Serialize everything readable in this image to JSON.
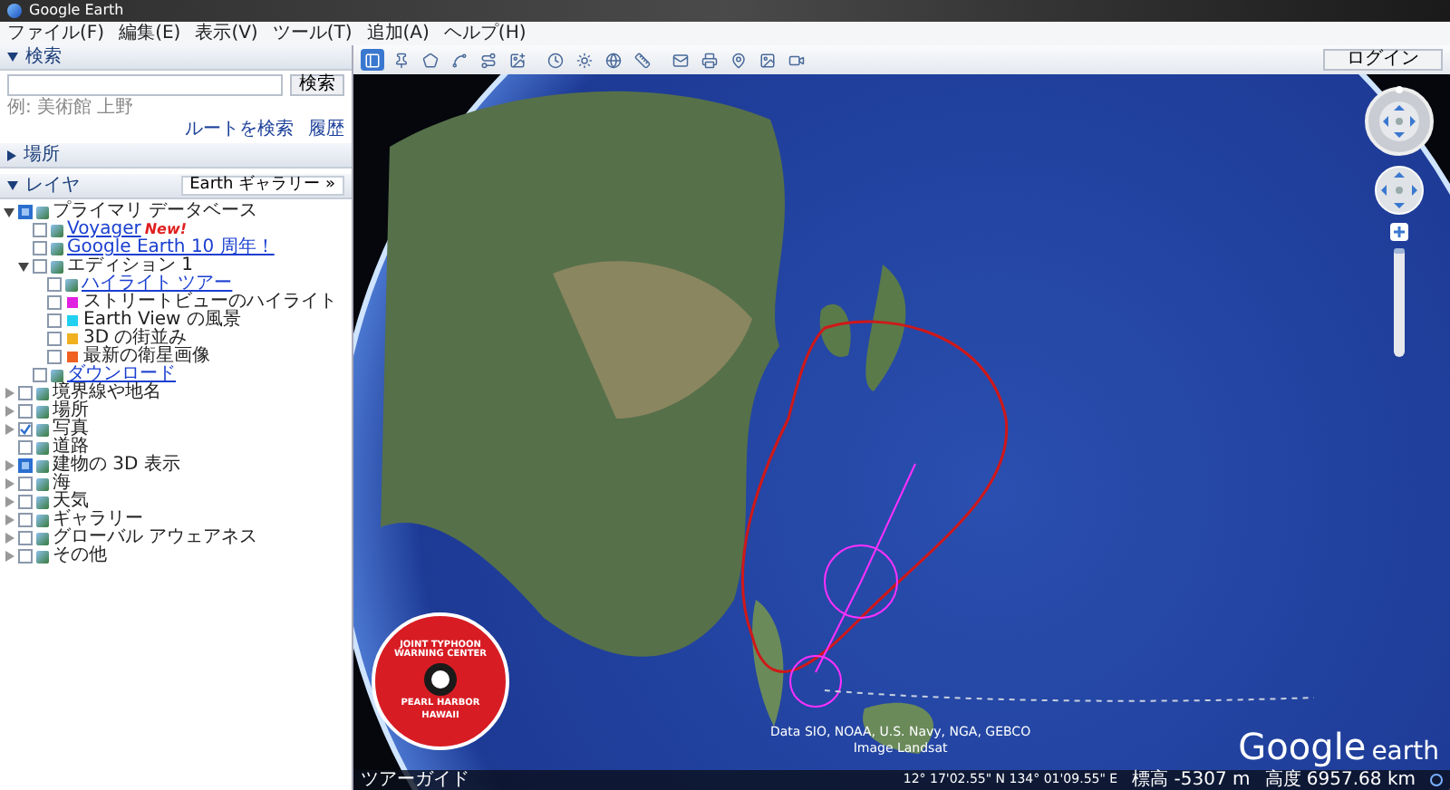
{
  "window": {
    "title": "Google Earth"
  },
  "menu": [
    "ファイル(F)",
    "編集(E)",
    "表示(V)",
    "ツール(T)",
    "追加(A)",
    "ヘルプ(H)"
  ],
  "search": {
    "title": "検索",
    "expanded": true,
    "button": "検索",
    "hint": "例: 美術館 上野",
    "links": [
      "ルートを検索",
      "履歴"
    ]
  },
  "places": {
    "title": "場所",
    "expanded": false
  },
  "layers": {
    "title": "レイヤ",
    "expanded": true,
    "gallery_button": "Earth ギャラリー »",
    "tree": [
      {
        "label": "プライマリ データベース",
        "checked": false,
        "mixed": true,
        "link": false,
        "expanded": true,
        "children": [
          {
            "label": "Voyager",
            "link": true,
            "badge": "New!",
            "checked": false,
            "mixed": false
          },
          {
            "label": "Google Earth 10 周年！",
            "link": true,
            "checked": false,
            "mixed": false
          },
          {
            "label": "エディション 1",
            "link": false,
            "checked": false,
            "mixed": false,
            "expanded": true,
            "children": [
              {
                "label": "ハイライト ツアー",
                "link": true,
                "checked": false,
                "mixed": false
              },
              {
                "label": "ストリートビューのハイライト",
                "link": false,
                "checked": false,
                "mixed": false,
                "color": "#e020e0"
              },
              {
                "label": "Earth View の風景",
                "link": false,
                "checked": false,
                "mixed": false,
                "color": "#20d0f0"
              },
              {
                "label": "3D の街並み",
                "link": false,
                "checked": false,
                "mixed": false,
                "color": "#f0b020"
              },
              {
                "label": "最新の衛星画像",
                "link": false,
                "checked": false,
                "mixed": false,
                "color": "#f06020"
              }
            ]
          },
          {
            "label": "ダウンロード",
            "link": true,
            "checked": false,
            "mixed": false
          }
        ]
      },
      {
        "label": "境界線や地名",
        "link": false,
        "checked": false,
        "mixed": false,
        "expanded": false
      },
      {
        "label": "場所",
        "link": false,
        "checked": false,
        "mixed": false,
        "expanded": false
      },
      {
        "label": "写真",
        "link": false,
        "checked": true,
        "expanded": false
      },
      {
        "label": "道路",
        "link": false,
        "checked": false,
        "mixed": false
      },
      {
        "label": "建物の 3D 表示",
        "link": false,
        "checked": false,
        "mixed": true,
        "expanded": false
      },
      {
        "label": "海",
        "link": false,
        "checked": false,
        "mixed": false,
        "expanded": false
      },
      {
        "label": "天気",
        "link": false,
        "checked": false,
        "mixed": false,
        "expanded": false
      },
      {
        "label": "ギャラリー",
        "link": false,
        "checked": false,
        "mixed": false,
        "expanded": false
      },
      {
        "label": "グローバル アウェアネス",
        "link": false,
        "checked": false,
        "mixed": false,
        "expanded": false
      },
      {
        "label": "その他",
        "link": false,
        "checked": false,
        "mixed": false,
        "expanded": false
      }
    ]
  },
  "toolbar": {
    "sidebar_shown": true,
    "login_button": "ログイン"
  },
  "map": {
    "zoom": {
      "level": 0.05
    },
    "attribution": [
      "Data SIO, NOAA, U.S. Navy, NGA, GEBCO",
      "Image Landsat"
    ],
    "overlay_logo": {
      "ring_text": "JOINT TYPHOON WARNING CENTER",
      "bottom_lines": [
        "PEARL HARBOR",
        "HAWAII"
      ]
    },
    "logo": {
      "word_1": "Google",
      "word_2": "earth"
    }
  },
  "status_bar": {
    "tour_guide": "ツアーガイド",
    "coordinates": "12° 17'02.55\" N  134° 01'09.55\" E",
    "elevation": "標高 -5307 m",
    "altitude": "高度 6957.68 km"
  }
}
